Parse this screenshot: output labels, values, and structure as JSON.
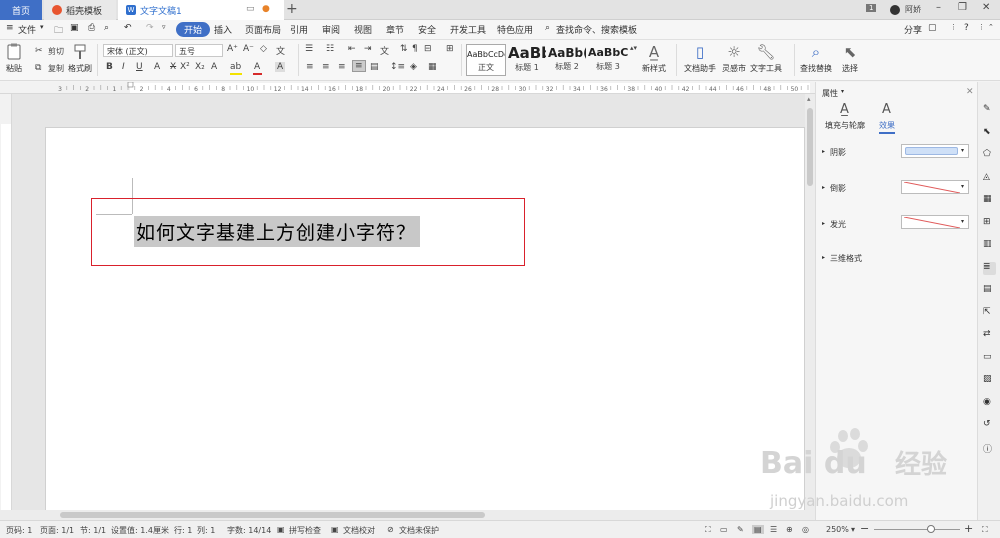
{
  "tabs": [
    {
      "label": "首页"
    },
    {
      "label": "稻壳模板"
    },
    {
      "label": "文字文稿1"
    }
  ],
  "titlebar": {
    "badge": "1",
    "user": "阿娇"
  },
  "menu": {
    "file": "文件",
    "items": [
      "开始",
      "插入",
      "页面布局",
      "引用",
      "审阅",
      "视图",
      "章节",
      "安全",
      "开发工具",
      "特色应用"
    ],
    "search": "查找命令、搜索模板",
    "share": "分享"
  },
  "ribbon": {
    "paste": "粘贴",
    "cut": "剪切",
    "copy": "复制",
    "format_painter": "格式刷",
    "font": "宋体 (正文)",
    "size": "五号",
    "styles": [
      {
        "sample": "AaBbCcDd",
        "label": "正文"
      },
      {
        "sample": "AaBb",
        "label": "标题 1"
      },
      {
        "sample": "AaBb(",
        "label": "标题 2"
      },
      {
        "sample": "AaBbC(",
        "label": "标题 3"
      }
    ],
    "new_style": "新样式",
    "doc_helper": "文档助手",
    "inspiration": "灵感市",
    "text_tools": "文字工具",
    "find_replace": "查找替换",
    "select": "选择"
  },
  "ruler_numbers": [
    "3",
    "2",
    "1",
    "2",
    "4",
    "6",
    "8",
    "10",
    "12",
    "14",
    "16",
    "18",
    "20",
    "22",
    "24",
    "26",
    "28",
    "30",
    "32",
    "34",
    "36",
    "38",
    "40",
    "42",
    "44",
    "46",
    "48",
    "50"
  ],
  "document": {
    "text": "如何文字基建上方创建小字符？"
  },
  "panel": {
    "title": "属性",
    "tab_fill": "填充与轮廓",
    "tab_effect": "效果",
    "shadow": "阴影",
    "reflection": "倒影",
    "glow": "发光",
    "three_d": "三维格式"
  },
  "status": {
    "page_num": "页码: 1",
    "pages": "页面: 1/1",
    "section": "节: 1/1",
    "setting": "设置值: 1.4厘米",
    "row": "行: 1",
    "col": "列: 1",
    "words": "字数: 14/14",
    "spell": "拼写检查",
    "proof": "文档校对",
    "protect": "文档未保护",
    "zoom": "250%"
  },
  "watermark": {
    "brand": "Baidu",
    "sub": "经验",
    "url": "jingyan.baidu.com"
  },
  "colors": {
    "accent": "#3f6fc6",
    "highlight_box": "#d9212c",
    "selection": "#c8c8c8",
    "font_color": "#d62b2b",
    "highlight": "#f3e200"
  }
}
